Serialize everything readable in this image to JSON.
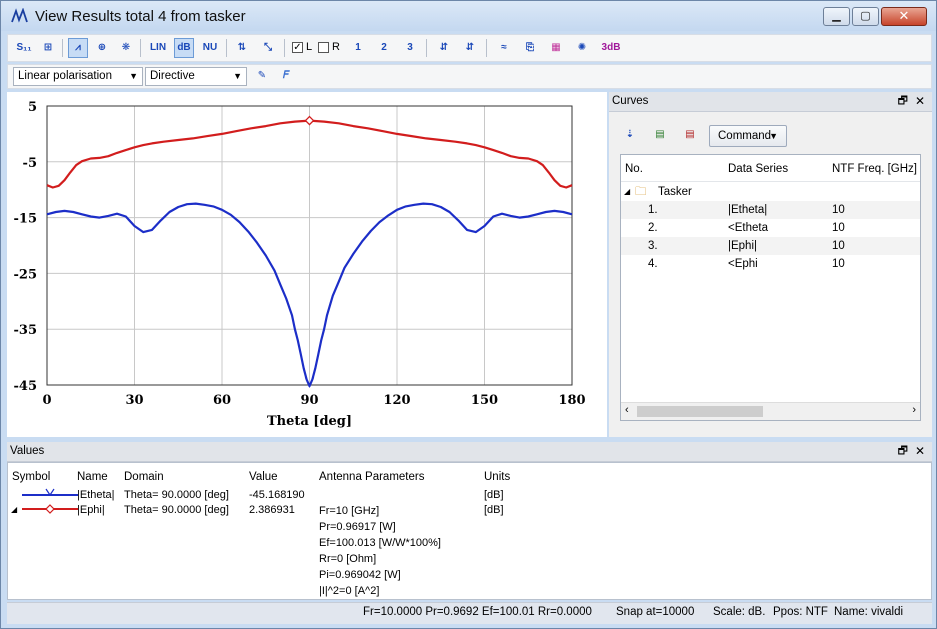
{
  "window": {
    "title": "View Results total 4 from tasker"
  },
  "toolbar2": {
    "polarisation": "Linear polarisation",
    "mode": "Directive"
  },
  "toolbar1": {
    "check_l_label": "L",
    "check_r_label": "R",
    "check_l_checked": true,
    "check_r_checked": false,
    "btn_1": "1",
    "btn_2": "2",
    "btn_3": "3",
    "btn_3db": "3dB"
  },
  "chart_data": {
    "type": "line",
    "xlabel": "Theta [deg]",
    "ylabel": "",
    "xlim": [
      0,
      180
    ],
    "ylim": [
      -45,
      5
    ],
    "xticks": [
      "0",
      "30",
      "60",
      "90",
      "120",
      "150",
      "180"
    ],
    "yticks": [
      "5",
      "-5",
      "-15",
      "-25",
      "-35",
      "-45"
    ],
    "grid": true,
    "series": [
      {
        "name": "|Etheta|",
        "color": "#1c2ec8",
        "x": [
          0,
          3,
          6,
          9,
          12,
          15,
          18,
          21,
          24,
          27,
          30,
          33,
          36,
          39,
          42,
          45,
          48,
          51,
          54,
          57,
          60,
          63,
          66,
          69,
          72,
          75,
          78,
          80,
          82,
          84,
          85,
          86,
          87,
          88,
          89,
          90,
          91,
          92,
          93,
          94,
          95,
          96,
          98,
          100,
          102,
          105,
          108,
          111,
          114,
          117,
          120,
          123,
          126,
          129,
          132,
          135,
          138,
          141,
          144,
          147,
          150,
          153,
          156,
          159,
          162,
          165,
          168,
          171,
          174,
          177,
          180
        ],
        "values": [
          -14.4,
          -14.0,
          -13.8,
          -14.0,
          -14.4,
          -14.8,
          -15.0,
          -14.7,
          -14.3,
          -14.8,
          -16.5,
          -17.6,
          -17.2,
          -15.5,
          -14.0,
          -13.1,
          -12.6,
          -12.5,
          -12.7,
          -13.0,
          -13.6,
          -14.5,
          -15.8,
          -17.5,
          -19.5,
          -21.8,
          -24.5,
          -27.0,
          -29.5,
          -32.5,
          -35.0,
          -37.0,
          -39.5,
          -42.0,
          -44.0,
          -45.2,
          -44.0,
          -42.0,
          -39.5,
          -37.0,
          -35.0,
          -32.5,
          -29.0,
          -26.5,
          -24.0,
          -21.5,
          -19.3,
          -17.4,
          -15.8,
          -14.6,
          -13.6,
          -13.0,
          -12.7,
          -12.5,
          -12.6,
          -13.1,
          -14.0,
          -15.5,
          -17.2,
          -17.6,
          -16.5,
          -14.8,
          -14.3,
          -14.7,
          -15.0,
          -14.8,
          -14.4,
          -14.0,
          -13.8,
          -14.0,
          -14.4
        ]
      },
      {
        "name": "|Ephi|",
        "color": "#d21d1d",
        "x": [
          0,
          2,
          4,
          6,
          8,
          10,
          12,
          15,
          18,
          21,
          24,
          27,
          30,
          33,
          36,
          40,
          45,
          50,
          55,
          60,
          65,
          70,
          75,
          80,
          85,
          90,
          95,
          100,
          105,
          110,
          115,
          120,
          125,
          130,
          135,
          140,
          144,
          147,
          150,
          153,
          156,
          159,
          162,
          165,
          168,
          170,
          172,
          174,
          176,
          178,
          180
        ],
        "values": [
          -9.2,
          -9.6,
          -9.3,
          -8.3,
          -6.9,
          -5.6,
          -4.9,
          -4.4,
          -4.3,
          -4.0,
          -3.4,
          -2.9,
          -2.4,
          -2.0,
          -1.7,
          -1.4,
          -1.1,
          -0.8,
          -0.4,
          0.0,
          0.5,
          1.0,
          1.4,
          1.9,
          2.2,
          2.39,
          2.2,
          1.9,
          1.4,
          1.0,
          0.5,
          0.0,
          -0.4,
          -0.8,
          -1.1,
          -1.4,
          -1.7,
          -2.0,
          -2.4,
          -2.9,
          -3.4,
          -4.0,
          -4.3,
          -4.4,
          -4.9,
          -5.6,
          -6.9,
          -8.3,
          -9.3,
          -9.6,
          -9.2
        ]
      }
    ]
  },
  "curves": {
    "panel_title": "Curves",
    "command_label": "Command",
    "columns": [
      "No.",
      "Data Series",
      "NTF Freq. [GHz]"
    ],
    "group": "Tasker",
    "rows": [
      {
        "no": "1.",
        "series": "|Etheta|",
        "freq": "10"
      },
      {
        "no": "2.",
        "series": "<Etheta",
        "freq": "10"
      },
      {
        "no": "3.",
        "series": "|Ephi|",
        "freq": "10"
      },
      {
        "no": "4.",
        "series": "<Ephi",
        "freq": "10"
      }
    ]
  },
  "values": {
    "panel_title": "Values",
    "columns": [
      "Symbol",
      "Name",
      "Domain",
      "Value",
      "Antenna Parameters",
      "Units"
    ],
    "rows": [
      {
        "name": "|Etheta|",
        "domain": "Theta= 90.0000 [deg]",
        "value": "-45.168190",
        "params": [],
        "units": "[dB]"
      },
      {
        "name": "|Ephi|",
        "domain": "Theta= 90.0000 [deg]",
        "value": "2.386931",
        "params": [
          "Fr=10 [GHz]",
          "Pr=0.96917 [W]",
          "Ef=100.013 [W/W*100%]",
          "Rr=0 [Ohm]",
          "Pi=0.969042 [W]",
          "|I|^2=0 [A^2]"
        ],
        "units": "[dB]"
      }
    ]
  },
  "status": {
    "params": "Fr=10.0000 Pr=0.9692 Ef=100.01 Rr=0.0000",
    "snap": "Snap at=10000",
    "scale": "Scale: dB.",
    "ppos": "Ppos: NTF",
    "name": "Name: vivaldi"
  }
}
